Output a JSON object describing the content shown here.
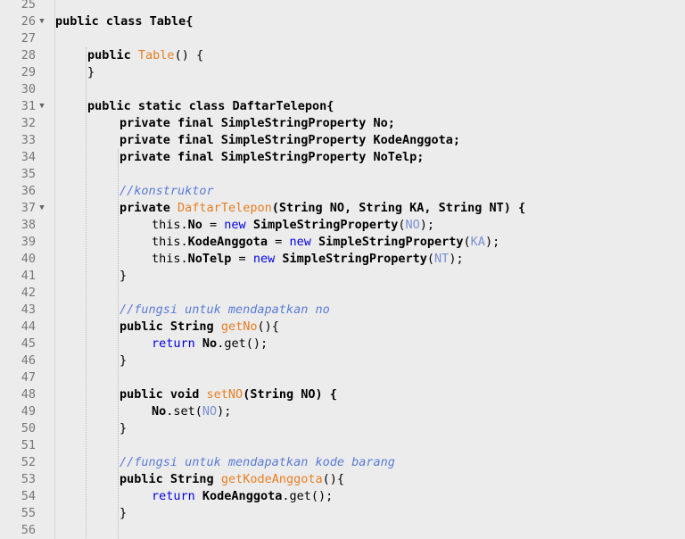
{
  "editor": {
    "lines": [
      {
        "num": "25",
        "fold": false,
        "indent": 0,
        "tokens": []
      },
      {
        "num": "26",
        "fold": true,
        "indent": 0,
        "tokens": [
          {
            "t": "public class Table{",
            "k": "b"
          }
        ]
      },
      {
        "num": "27",
        "fold": false,
        "indent": 0,
        "tokens": []
      },
      {
        "num": "28",
        "fold": false,
        "indent": 1,
        "tokens": [
          {
            "t": "public",
            "k": "b"
          },
          {
            "t": " ",
            "k": "n"
          },
          {
            "t": "Table",
            "k": "m"
          },
          {
            "t": "() {",
            "k": "n"
          }
        ]
      },
      {
        "num": "29",
        "fold": false,
        "indent": 1,
        "tokens": [
          {
            "t": "}",
            "k": "n"
          }
        ]
      },
      {
        "num": "30",
        "fold": false,
        "indent": 0,
        "tokens": []
      },
      {
        "num": "31",
        "fold": true,
        "indent": 1,
        "tokens": [
          {
            "t": "public static class DaftarTelepon{",
            "k": "b"
          }
        ]
      },
      {
        "num": "32",
        "fold": false,
        "indent": 2,
        "tokens": [
          {
            "t": "private final SimpleStringProperty No;",
            "k": "b"
          }
        ]
      },
      {
        "num": "33",
        "fold": false,
        "indent": 2,
        "tokens": [
          {
            "t": "private final SimpleStringProperty KodeAnggota;",
            "k": "b"
          }
        ]
      },
      {
        "num": "34",
        "fold": false,
        "indent": 2,
        "tokens": [
          {
            "t": "private final SimpleStringProperty NoTelp;",
            "k": "b"
          }
        ]
      },
      {
        "num": "35",
        "fold": false,
        "indent": 0,
        "tokens": []
      },
      {
        "num": "36",
        "fold": false,
        "indent": 2,
        "tokens": [
          {
            "t": "//konstruktor",
            "k": "c"
          }
        ]
      },
      {
        "num": "37",
        "fold": true,
        "indent": 2,
        "tokens": [
          {
            "t": "private",
            "k": "b"
          },
          {
            "t": " ",
            "k": "n"
          },
          {
            "t": "DaftarTelepon",
            "k": "m"
          },
          {
            "t": "(String NO, String KA, String NT) {",
            "k": "b"
          }
        ]
      },
      {
        "num": "38",
        "fold": false,
        "indent": 3,
        "tokens": [
          {
            "t": "this.",
            "k": "n"
          },
          {
            "t": "No",
            "k": "b"
          },
          {
            "t": " = ",
            "k": "n"
          },
          {
            "t": "new",
            "k": "kw"
          },
          {
            "t": " ",
            "k": "n"
          },
          {
            "t": "SimpleStringProperty",
            "k": "b"
          },
          {
            "t": "(",
            "k": "n"
          },
          {
            "t": "NO",
            "k": "p"
          },
          {
            "t": ");",
            "k": "n"
          }
        ]
      },
      {
        "num": "39",
        "fold": false,
        "indent": 3,
        "tokens": [
          {
            "t": "this.",
            "k": "n"
          },
          {
            "t": "KodeAnggota",
            "k": "b"
          },
          {
            "t": " = ",
            "k": "n"
          },
          {
            "t": "new",
            "k": "kw"
          },
          {
            "t": " ",
            "k": "n"
          },
          {
            "t": "SimpleStringProperty",
            "k": "b"
          },
          {
            "t": "(",
            "k": "n"
          },
          {
            "t": "KA",
            "k": "p"
          },
          {
            "t": ");",
            "k": "n"
          }
        ]
      },
      {
        "num": "40",
        "fold": false,
        "indent": 3,
        "tokens": [
          {
            "t": "this.",
            "k": "n"
          },
          {
            "t": "NoTelp",
            "k": "b"
          },
          {
            "t": " = ",
            "k": "n"
          },
          {
            "t": "new",
            "k": "kw"
          },
          {
            "t": " ",
            "k": "n"
          },
          {
            "t": "SimpleStringProperty",
            "k": "b"
          },
          {
            "t": "(",
            "k": "n"
          },
          {
            "t": "NT",
            "k": "p"
          },
          {
            "t": ");",
            "k": "n"
          }
        ]
      },
      {
        "num": "41",
        "fold": false,
        "indent": 2,
        "tokens": [
          {
            "t": "}",
            "k": "n"
          }
        ]
      },
      {
        "num": "42",
        "fold": false,
        "indent": 0,
        "tokens": []
      },
      {
        "num": "43",
        "fold": false,
        "indent": 2,
        "tokens": [
          {
            "t": "//fungsi untuk mendapatkan no",
            "k": "c"
          }
        ]
      },
      {
        "num": "44",
        "fold": false,
        "indent": 2,
        "tokens": [
          {
            "t": "public String",
            "k": "b"
          },
          {
            "t": " ",
            "k": "n"
          },
          {
            "t": "getNo",
            "k": "m"
          },
          {
            "t": "(){",
            "k": "n"
          }
        ]
      },
      {
        "num": "45",
        "fold": false,
        "indent": 3,
        "tokens": [
          {
            "t": "return",
            "k": "kw"
          },
          {
            "t": " ",
            "k": "n"
          },
          {
            "t": "No",
            "k": "b"
          },
          {
            "t": ".get();",
            "k": "n"
          }
        ]
      },
      {
        "num": "46",
        "fold": false,
        "indent": 2,
        "tokens": [
          {
            "t": "}",
            "k": "n"
          }
        ]
      },
      {
        "num": "47",
        "fold": false,
        "indent": 0,
        "tokens": []
      },
      {
        "num": "48",
        "fold": false,
        "indent": 2,
        "tokens": [
          {
            "t": "public void",
            "k": "b"
          },
          {
            "t": " ",
            "k": "n"
          },
          {
            "t": "setNO",
            "k": "m"
          },
          {
            "t": "(String NO) {",
            "k": "b"
          }
        ]
      },
      {
        "num": "49",
        "fold": false,
        "indent": 3,
        "tokens": [
          {
            "t": "No",
            "k": "b"
          },
          {
            "t": ".set(",
            "k": "n"
          },
          {
            "t": "NO",
            "k": "p"
          },
          {
            "t": ");",
            "k": "n"
          }
        ]
      },
      {
        "num": "50",
        "fold": false,
        "indent": 2,
        "tokens": [
          {
            "t": "}",
            "k": "n"
          }
        ]
      },
      {
        "num": "51",
        "fold": false,
        "indent": 0,
        "tokens": []
      },
      {
        "num": "52",
        "fold": false,
        "indent": 2,
        "tokens": [
          {
            "t": "//fungsi untuk mendapatkan kode barang",
            "k": "c"
          }
        ]
      },
      {
        "num": "53",
        "fold": false,
        "indent": 2,
        "tokens": [
          {
            "t": "public String",
            "k": "b"
          },
          {
            "t": " ",
            "k": "n"
          },
          {
            "t": "getKodeAnggota",
            "k": "m"
          },
          {
            "t": "(){",
            "k": "n"
          }
        ]
      },
      {
        "num": "54",
        "fold": false,
        "indent": 3,
        "tokens": [
          {
            "t": "return",
            "k": "kw"
          },
          {
            "t": " ",
            "k": "n"
          },
          {
            "t": "KodeAnggota",
            "k": "b"
          },
          {
            "t": ".get();",
            "k": "n"
          }
        ]
      },
      {
        "num": "55",
        "fold": false,
        "indent": 2,
        "tokens": [
          {
            "t": "}",
            "k": "n"
          }
        ]
      },
      {
        "num": "56",
        "fold": false,
        "indent": 0,
        "tokens": []
      }
    ]
  },
  "colors": {
    "background": "#ececec",
    "keyword": "#0000e6",
    "method": "#e67e22",
    "comment": "#5b7bd6",
    "parameter": "#7a8fd4",
    "line_number": "#777777"
  },
  "icons": {
    "fold": "fold-arrow-icon"
  }
}
